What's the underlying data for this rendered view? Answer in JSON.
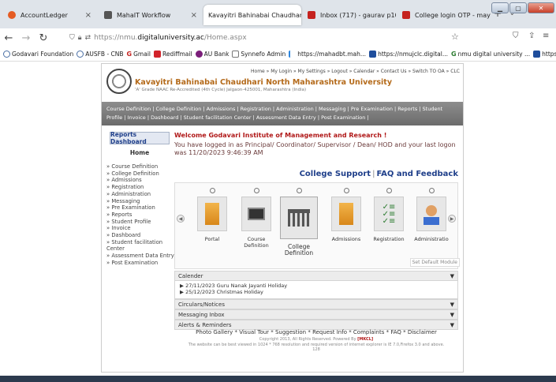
{
  "browser": {
    "tabs": [
      {
        "label": "AccountLedger",
        "icon": "firefox-icon",
        "color": "#e55b23"
      },
      {
        "label": "MahaIT Workflow",
        "icon": "workflow-icon",
        "color": "#555555"
      },
      {
        "label": "Kavayitri Bahinabai Chaudhari Nor",
        "icon": "page-icon",
        "color": "#999999"
      },
      {
        "label": "Inbox (717) - gaurav p1092@g",
        "icon": "gmail-icon",
        "color": "#c5221f"
      },
      {
        "label": "College login OTP - mayur24",
        "icon": "gmail-icon",
        "color": "#c5221f"
      }
    ],
    "new_tab": "+",
    "url_scheme": "https://nmu.",
    "url_host": "digitaluniversity.ac",
    "url_path": "/Home.aspx",
    "bookmarks": [
      {
        "label": "Godavari Foundation",
        "color": "#4a6fa5"
      },
      {
        "label": "AUSFB - CNB",
        "color": "#4a6fa5"
      },
      {
        "label": "Gmail",
        "color": "#c5221f"
      },
      {
        "label": "Rediffmail",
        "color": "#d2232a"
      },
      {
        "label": "AU Bank",
        "color": "#7b1e7a"
      },
      {
        "label": "Synnefo Admin",
        "color": "#777777"
      },
      {
        "label": "https://mahadbt.mah...",
        "color": "#2e86de"
      },
      {
        "label": "https://nmujclc.digital...",
        "color": "#1f4e9c"
      },
      {
        "label": "nmu digital university ...",
        "color": "#2e7d32"
      },
      {
        "label": "https://smtdclc.digital...",
        "color": "#1f4e9c"
      }
    ]
  },
  "site": {
    "university_name": "Kavayitri Bahinabai Chaudhari North Maharashtra University",
    "university_address": "'A' Grade NAAC Re-Accredited (4th Cycle) Jalgaon-425001, Maharashtra (India)",
    "top_links": "Home » My Login » My Settings » Logout » Calendar » Contact Us » Switch TO OA » CLC",
    "top_links2": "",
    "menu": "Course Definition | College Definition | Admissions | Registration | Administration | Messaging | Pre Examination | Reports | Student Profile | Invoice | Dashboard | Student facilitation Center | Assessment Data Entry | Post Examination |",
    "sidebar": {
      "reports_dashboard": "Reports Dashboard",
      "home": "Home",
      "items": [
        "» Course Definition",
        "» College Definition",
        "» Admissions",
        "» Registration",
        "» Administration",
        "» Messaging",
        "» Pre Examination",
        "» Reports",
        "» Student Profile",
        "» Invoice",
        "» Dashboard",
        "» Student facilitation Center",
        "» Assessment Data Entry",
        "» Post Examination"
      ]
    },
    "welcome": "Welcome Godavari Institute of Management and Research !",
    "logon_message": "You have logged in as Principal/ Coordinator/ Supervisor / Dean/ HOD and your last logon was 11/20/2023 9:46:39 AM",
    "support_link": "College Support",
    "support_sep": "|",
    "faq_link": "FAQ and Feedback",
    "carousel": [
      {
        "label": "Portal",
        "icon": "portal-icon"
      },
      {
        "label": "Course Definition",
        "icon": "computer-icon"
      },
      {
        "label": "College Definition",
        "icon": "building-icon"
      },
      {
        "label": "Admissions",
        "icon": "folder-icon"
      },
      {
        "label": "Registration",
        "icon": "checklist-icon"
      },
      {
        "label": "Administratio",
        "icon": "user-pencil-icon"
      }
    ],
    "set_default_module": "Set Default Module",
    "panels": {
      "calendar": "Calender",
      "calendar_items": [
        "▶ 27/11/2023 Guru Nanak Jayanti Holiday",
        "▶ 25/12/2023 Christmas Holiday"
      ],
      "circulars": "Circulars/Notices",
      "messaging": "Messaging Inbox",
      "alerts": "Alerts & Reminders"
    },
    "footer": {
      "links": "Photo Gallery  * Visual Tour  * Suggestion  * Request Info  * Complaints  * FAQ  * Disclaimer",
      "copyright": "Copyright 2013, All Rights Reserved. Powered By ",
      "powered_by": "[MKCL]",
      "best_viewed": "The website can be best viewed in 1024 * 768 resolution and required version of internet explorer is IE 7.0,Firefox 3.0 and above.",
      "hits": "128"
    }
  }
}
